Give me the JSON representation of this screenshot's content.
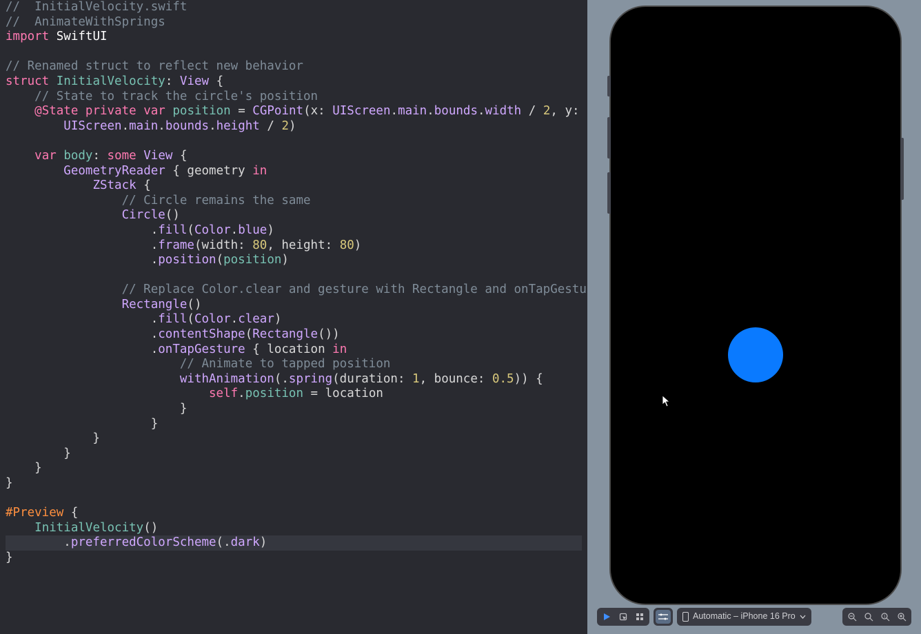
{
  "code": {
    "l1": "//  InitialVelocity.swift",
    "l2": "//  AnimateWithSprings",
    "l3_kw": "import",
    "l3_mod": "SwiftUI",
    "l5": "// Renamed struct to reflect new behavior",
    "l6_kw1": "struct",
    "l6_name": "InitialVelocity",
    "l6_proto": "View",
    "l7": "// State to track the circle's position",
    "l8_state": "@State",
    "l8_priv": "private",
    "l8_var": "var",
    "l8_name": "position",
    "l8_eq": " = ",
    "l8_cgpoint": "CGPoint",
    "l8_x": "x",
    "l8_uiscreen": "UIScreen",
    "l8_main": "main",
    "l8_bounds": "bounds",
    "l8_width": "width",
    "l8_height": "height",
    "l8_div2": " / ",
    "l8_num2": "2",
    "l8_y": "y",
    "l10_var": "var",
    "l10_body": "body",
    "l10_some": "some",
    "l10_view": "View",
    "l11_geo": "GeometryReader",
    "l11_param": "geometry",
    "l11_in": "in",
    "l12_zstack": "ZStack",
    "l13": "// Circle remains the same",
    "l14_circle": "Circle",
    "l15_fill": "fill",
    "l15_color": "Color",
    "l15_blue": "blue",
    "l16_frame": "frame",
    "l16_w": "width",
    "l16_h": "height",
    "l16_80": "80",
    "l17_position": "position",
    "l17_arg": "position",
    "l19": "// Replace Color.clear and gesture with Rectangle and onTapGesture",
    "l20_rect": "Rectangle",
    "l21_fill": "fill",
    "l21_color": "Color",
    "l21_clear": "clear",
    "l22_cshape": "contentShape",
    "l22_rect": "Rectangle",
    "l23_ontap": "onTapGesture",
    "l23_loc": "location",
    "l23_in": "in",
    "l24": "// Animate to tapped position",
    "l25_wa": "withAnimation",
    "l25_spring": "spring",
    "l25_dur": "duration",
    "l25_1": "1",
    "l25_bounce": "bounce",
    "l25_05": "0.5",
    "l26_self": "self",
    "l26_pos": "position",
    "l26_loc": "location",
    "l33_preview": "#Preview",
    "l34_iv": "InitialVelocity",
    "l35_pcs": "preferredColorScheme",
    "l35_dark": "dark"
  },
  "preview": {
    "circle_color": "#0A7AFF"
  },
  "toolbar": {
    "device_label": "Automatic – iPhone 16 Pro"
  }
}
